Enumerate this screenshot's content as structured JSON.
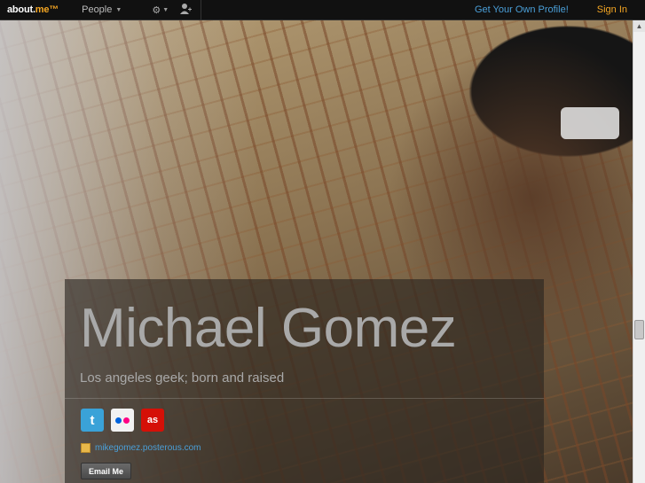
{
  "topbar": {
    "logo_prefix": "about.",
    "logo_suffix": "me™",
    "people_label": "People",
    "get_profile_label": "Get Your Own Profile!",
    "sign_in_label": "Sign In"
  },
  "profile": {
    "name": "Michael Gomez",
    "tagline": "Los angeles geek; born and raised",
    "social": [
      {
        "service": "twitter",
        "icon": "twitter-icon",
        "glyph": "t"
      },
      {
        "service": "flickr",
        "icon": "flickr-icon"
      },
      {
        "service": "lastfm",
        "icon": "lastfm-icon",
        "glyph": "as"
      }
    ],
    "link": "mikegomez.posterous.com",
    "email_button": "Email Me"
  },
  "colors": {
    "accent_orange": "#f5a623",
    "link_blue": "#4a9fd8",
    "topbar_bg": "#111111"
  }
}
